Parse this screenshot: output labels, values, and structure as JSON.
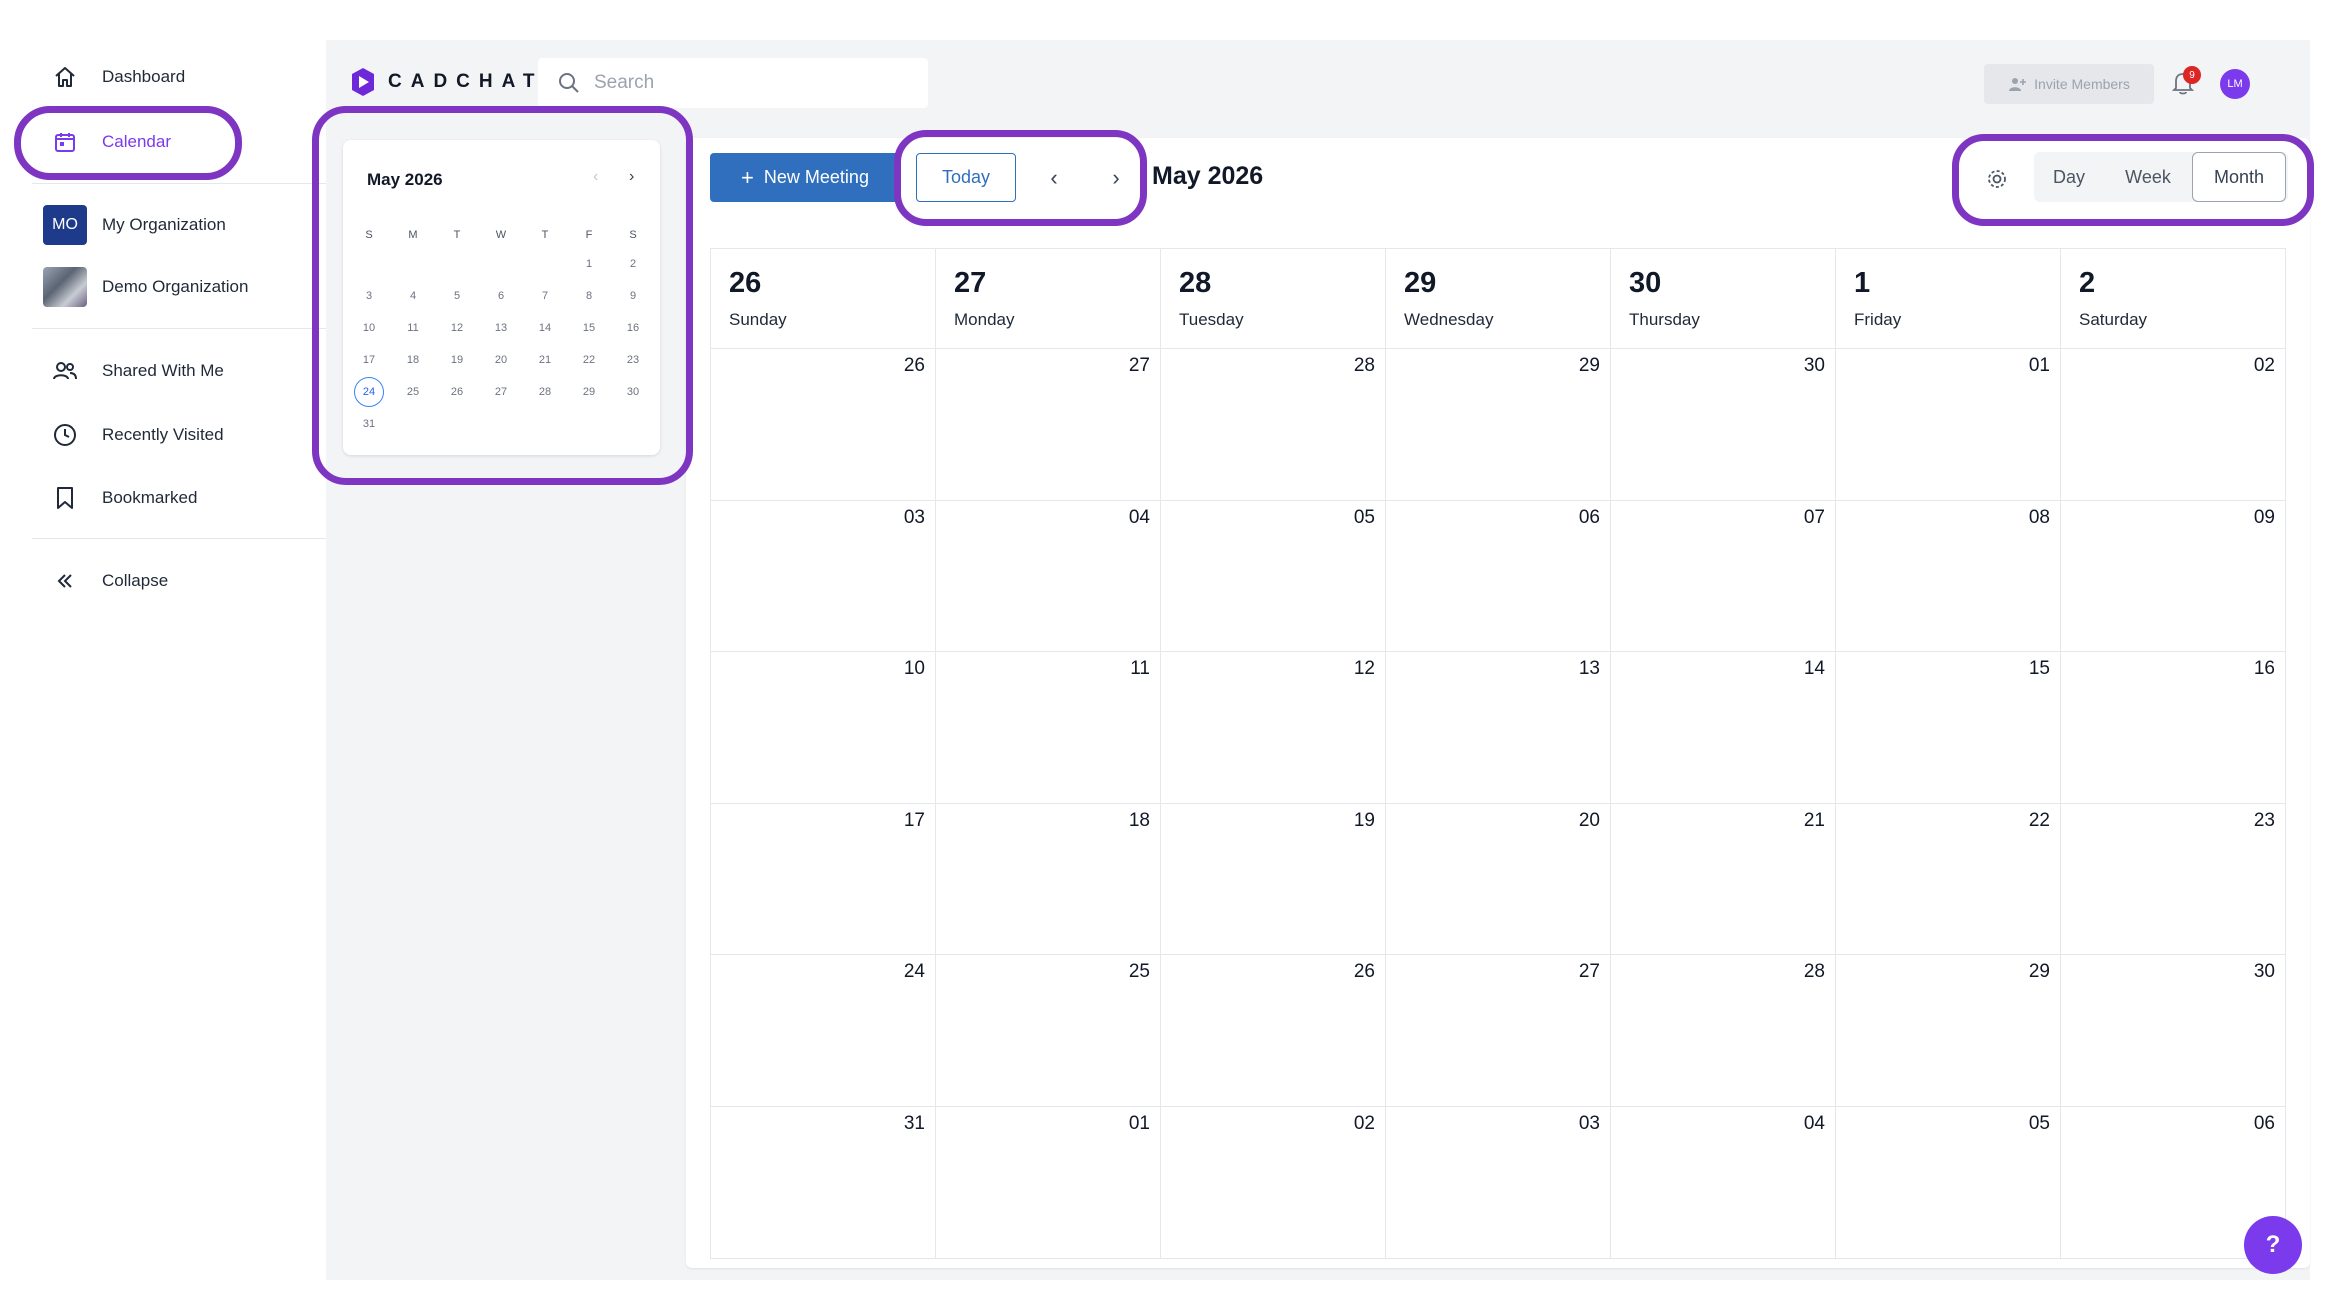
{
  "sidebar": {
    "items": [
      {
        "label": "Dashboard",
        "icon": "home-icon"
      },
      {
        "label": "Calendar",
        "icon": "calendar-icon"
      },
      {
        "label": "My Organization",
        "badge": "MO"
      },
      {
        "label": "Demo Organization"
      },
      {
        "label": "Shared With Me",
        "icon": "users-icon"
      },
      {
        "label": "Recently Visited",
        "icon": "clock-icon"
      },
      {
        "label": "Bookmarked",
        "icon": "bookmark-icon"
      },
      {
        "label": "Collapse",
        "icon": "double-chevron-left-icon"
      }
    ]
  },
  "header": {
    "logo_text": "CADCHAT",
    "search_placeholder": "Search",
    "invite_label": "Invite Members",
    "notification_count": "9",
    "avatar_initials": "LM"
  },
  "mini_calendar": {
    "title": "May 2026",
    "prev": "‹",
    "next": "›",
    "weekdays": [
      "S",
      "M",
      "T",
      "W",
      "T",
      "F",
      "S"
    ],
    "weeks": [
      [
        "",
        "",
        "",
        "",
        "",
        "1",
        "2"
      ],
      [
        "3",
        "4",
        "5",
        "6",
        "7",
        "8",
        "9"
      ],
      [
        "10",
        "11",
        "12",
        "13",
        "14",
        "15",
        "16"
      ],
      [
        "17",
        "18",
        "19",
        "20",
        "21",
        "22",
        "23"
      ],
      [
        "24",
        "25",
        "26",
        "27",
        "28",
        "29",
        "30"
      ],
      [
        "31",
        "",
        "",
        "",
        "",
        "",
        ""
      ]
    ],
    "today": "24"
  },
  "toolbar": {
    "new_meeting_label": "New Meeting",
    "today_label": "Today",
    "prev_label": "‹",
    "next_label": "›",
    "month_title": "May 2026",
    "views": {
      "day": "Day",
      "week": "Week",
      "month": "Month"
    },
    "selected_view": "Month"
  },
  "month_grid": {
    "header": [
      {
        "num": "26",
        "day": "Sunday"
      },
      {
        "num": "27",
        "day": "Monday"
      },
      {
        "num": "28",
        "day": "Tuesday"
      },
      {
        "num": "29",
        "day": "Wednesday"
      },
      {
        "num": "30",
        "day": "Thursday"
      },
      {
        "num": "1",
        "day": "Friday"
      },
      {
        "num": "2",
        "day": "Saturday"
      }
    ],
    "weeks": [
      [
        "26",
        "27",
        "28",
        "29",
        "30",
        "01",
        "02"
      ],
      [
        "03",
        "04",
        "05",
        "06",
        "07",
        "08",
        "09"
      ],
      [
        "10",
        "11",
        "12",
        "13",
        "14",
        "15",
        "16"
      ],
      [
        "17",
        "18",
        "19",
        "20",
        "21",
        "22",
        "23"
      ],
      [
        "24",
        "25",
        "26",
        "27",
        "28",
        "29",
        "30"
      ],
      [
        "31",
        "01",
        "02",
        "03",
        "04",
        "05",
        "06"
      ]
    ]
  },
  "help_label": "?",
  "colors": {
    "accent": "#7c3aed",
    "primary_button": "#2f6fbd",
    "highlight": "#7e35c2",
    "background": "#f3f4f6"
  }
}
